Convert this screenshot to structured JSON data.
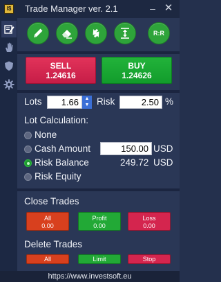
{
  "window": {
    "title": "Trade Manager ver. 2.1",
    "app_icon_text": "I$",
    "minimize": "–",
    "close": "✕"
  },
  "sidebar": {
    "items": [
      {
        "icon": "edit-icon",
        "active": true
      },
      {
        "icon": "hand-icon",
        "active": false
      },
      {
        "icon": "shield-icon",
        "active": false
      },
      {
        "icon": "gear-icon",
        "active": false
      }
    ]
  },
  "toolbar": {
    "buttons": [
      {
        "icon": "pencil-icon"
      },
      {
        "icon": "eraser-icon"
      },
      {
        "icon": "reverse-icon"
      },
      {
        "icon": "expand-vertical-icon"
      },
      {
        "icon": "risk-reward-icon",
        "label": "R:R"
      }
    ]
  },
  "trade": {
    "sell_label": "SELL",
    "sell_price": "1.24616",
    "buy_label": "BUY",
    "buy_price": "1.24626"
  },
  "lots": {
    "label": "Lots",
    "value": "1.66",
    "risk_label": "Risk",
    "risk_value": "2.50",
    "risk_unit": "%"
  },
  "lot_calc": {
    "heading": "Lot Calculation:",
    "options": [
      {
        "label": "None",
        "checked": false
      },
      {
        "label": "Cash Amount",
        "checked": false,
        "value": "150.00",
        "unit": "USD"
      },
      {
        "label": "Risk Balance",
        "checked": true,
        "value": "249.72",
        "unit": "USD"
      },
      {
        "label": "Risk Equity",
        "checked": false
      }
    ]
  },
  "close_trades": {
    "heading": "Close Trades",
    "all_label": "All",
    "all_value": "0.00",
    "profit_label": "Profit",
    "profit_value": "0.00",
    "loss_label": "Loss",
    "loss_value": "0.00"
  },
  "delete_trades": {
    "heading": "Delete Trades",
    "all_label": "All",
    "limit_label": "Limit",
    "stop_label": "Stop"
  },
  "footer": {
    "url": "https://www.investsoft.eu"
  },
  "colors": {
    "background": "#2a3756",
    "sell": "#d6264f",
    "buy": "#1aa633",
    "tool_green": "#2ea43a",
    "close_all": "#d8401e",
    "close_loss": "#d4254e"
  }
}
